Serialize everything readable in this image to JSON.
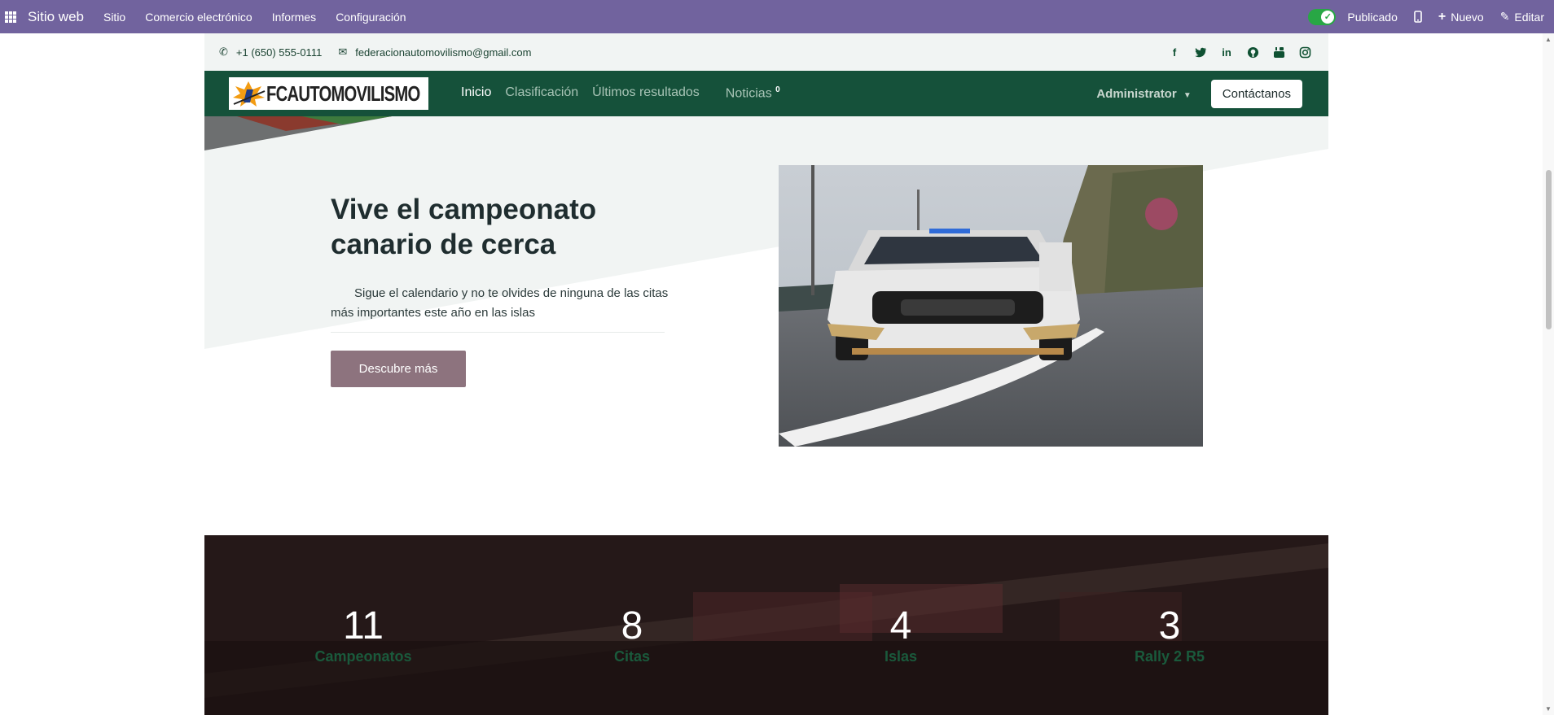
{
  "adminbar": {
    "brand": "Sitio web",
    "menus": [
      "Sitio",
      "Comercio electrónico",
      "Informes",
      "Configuración"
    ],
    "published_label": "Publicado",
    "new_label": "Nuevo",
    "edit_label": "Editar"
  },
  "topbar": {
    "phone": "+1 (650) 555-0111",
    "email": "federacionautomovilismo@gmail.com",
    "socials": [
      "facebook-icon",
      "twitter-icon",
      "linkedin-icon",
      "github-icon",
      "youtube-icon",
      "instagram-icon"
    ]
  },
  "navbar": {
    "logo_text": "FCAUTOMOVILISMO",
    "items": [
      "Inicio",
      "Clasificación",
      "Últimos resultados"
    ],
    "news_label": "Noticias",
    "news_count": "0",
    "admin_label": "Administrator",
    "contact_label": "Contáctanos"
  },
  "hero": {
    "title": "Vive el campeonato canario de cerca",
    "text": "Sigue el calendario y no te olvides de ninguna de las citas más importantes este año en las islas",
    "button": "Descubre más"
  },
  "stats": [
    {
      "num": "11",
      "label": "Campeonatos"
    },
    {
      "num": "8",
      "label": "Citas"
    },
    {
      "num": "4",
      "label": "Islas"
    },
    {
      "num": "3",
      "label": "Rally 2 R5"
    }
  ],
  "colors": {
    "adminbar": "#71639e",
    "navbar": "#15513a",
    "hero_button": "#8d737e",
    "stat_label": "#1a5a3c"
  }
}
